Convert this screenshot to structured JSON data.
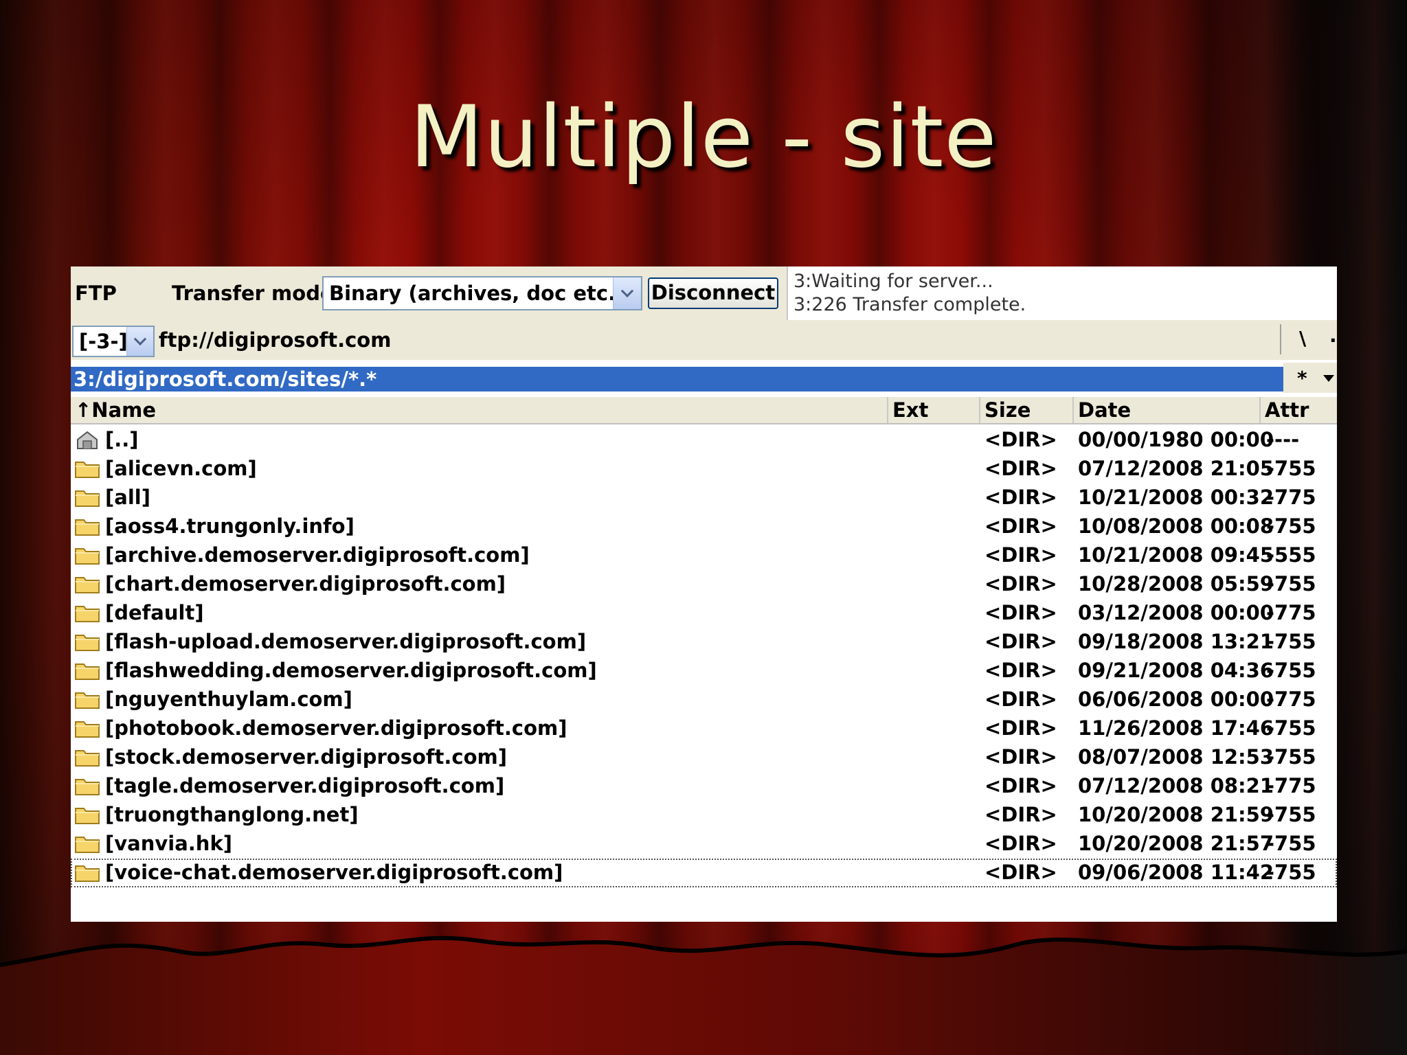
{
  "slide": {
    "title": "Multiple - site"
  },
  "toolbar": {
    "ftp_label": "FTP",
    "transfer_mode_label": "Transfer mode",
    "transfer_mode_value": "Binary (archives, doc etc.)",
    "disconnect_label": "Disconnect",
    "log": [
      "3:Waiting for server...",
      "3:226 Transfer complete."
    ]
  },
  "pathbar": {
    "connection_value": "[-3-]",
    "url": "ftp://digiprosoft.com",
    "root_label": "\\",
    "up_label": ".."
  },
  "current_path": "3:/digiprosoft.com/sites/*.*",
  "filter_label": "*",
  "columns": {
    "name": "↑Name",
    "ext": "Ext",
    "size": "Size",
    "date": "Date",
    "attr": "Attr"
  },
  "files": [
    {
      "name": "[..]",
      "size": "<DIR>",
      "date": "00/00/1980 00:00",
      "attr": "----",
      "icon": "parent-folder-icon"
    },
    {
      "name": "[alicevn.com]",
      "size": "<DIR>",
      "date": "07/12/2008 21:05",
      "attr": "-755",
      "icon": "folder-icon"
    },
    {
      "name": "[all]",
      "size": "<DIR>",
      "date": "10/21/2008 00:32",
      "attr": "-775",
      "icon": "folder-icon"
    },
    {
      "name": "[aoss4.trungonly.info]",
      "size": "<DIR>",
      "date": "10/08/2008 00:08",
      "attr": "-755",
      "icon": "folder-icon"
    },
    {
      "name": "[archive.demoserver.digiprosoft.com]",
      "size": "<DIR>",
      "date": "10/21/2008 09:45",
      "attr": "-555",
      "icon": "folder-icon"
    },
    {
      "name": "[chart.demoserver.digiprosoft.com]",
      "size": "<DIR>",
      "date": "10/28/2008 05:59",
      "attr": "-755",
      "icon": "folder-icon"
    },
    {
      "name": "[default]",
      "size": "<DIR>",
      "date": "03/12/2008 00:00",
      "attr": "-775",
      "icon": "folder-icon"
    },
    {
      "name": "[flash-upload.demoserver.digiprosoft.com]",
      "size": "<DIR>",
      "date": "09/18/2008 13:21",
      "attr": "-755",
      "icon": "folder-icon"
    },
    {
      "name": "[flashwedding.demoserver.digiprosoft.com]",
      "size": "<DIR>",
      "date": "09/21/2008 04:36",
      "attr": "-755",
      "icon": "folder-icon"
    },
    {
      "name": "[nguyenthuylam.com]",
      "size": "<DIR>",
      "date": "06/06/2008 00:00",
      "attr": "-775",
      "icon": "folder-icon"
    },
    {
      "name": "[photobook.demoserver.digiprosoft.com]",
      "size": "<DIR>",
      "date": "11/26/2008 17:46",
      "attr": "-755",
      "icon": "folder-icon"
    },
    {
      "name": "[stock.demoserver.digiprosoft.com]",
      "size": "<DIR>",
      "date": "08/07/2008 12:53",
      "attr": "-755",
      "icon": "folder-icon"
    },
    {
      "name": "[tagle.demoserver.digiprosoft.com]",
      "size": "<DIR>",
      "date": "07/12/2008 08:21",
      "attr": "-775",
      "icon": "folder-icon"
    },
    {
      "name": "[truongthanglong.net]",
      "size": "<DIR>",
      "date": "10/20/2008 21:59",
      "attr": "-755",
      "icon": "folder-icon"
    },
    {
      "name": "[vanvia.hk]",
      "size": "<DIR>",
      "date": "10/20/2008 21:57",
      "attr": "-755",
      "icon": "folder-icon"
    },
    {
      "name": "[voice-chat.demoserver.digiprosoft.com]",
      "size": "<DIR>",
      "date": "09/06/2008 11:42",
      "attr": "-755",
      "icon": "folder-icon",
      "focused": true
    }
  ],
  "colors": {
    "selection": "#316ac5",
    "folder": "#f6d46a",
    "title": "#f3f0c4"
  }
}
